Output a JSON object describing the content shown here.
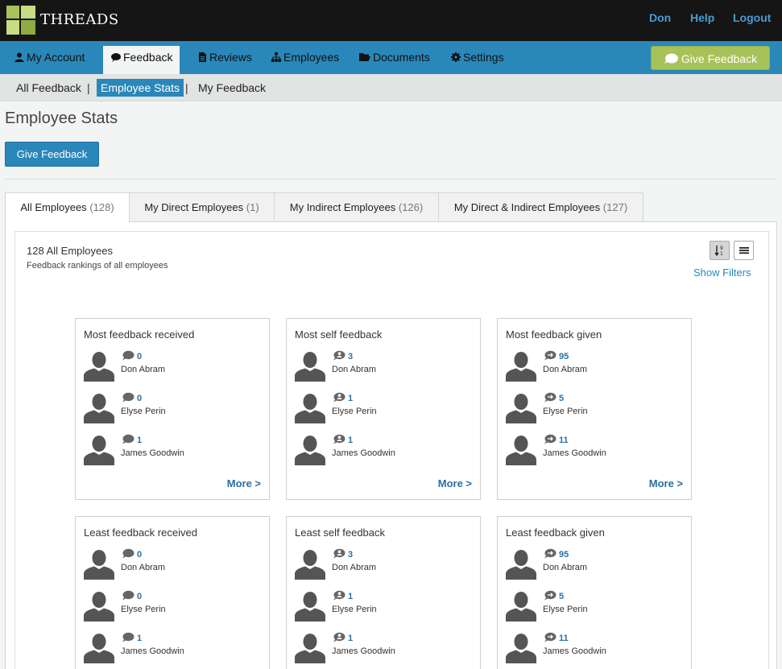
{
  "app": {
    "brand": "THREADS",
    "top_links": [
      "Don",
      "Help",
      "Logout"
    ]
  },
  "nav": {
    "items": [
      {
        "label": "My Account",
        "icon": "user-icon"
      },
      {
        "label": "Feedback",
        "icon": "comment-icon",
        "active": true
      },
      {
        "label": "Reviews",
        "icon": "file-icon"
      },
      {
        "label": "Employees",
        "icon": "sitemap-icon"
      },
      {
        "label": "Documents",
        "icon": "folder-icon"
      },
      {
        "label": "Settings",
        "icon": "gear-icon"
      }
    ],
    "give_feedback": "Give Feedback"
  },
  "subnav": {
    "items": [
      "All Feedback",
      "Employee Stats",
      "My Feedback"
    ],
    "separator": "|",
    "active_index": 1
  },
  "page": {
    "title": "Employee Stats",
    "give_feedback_button": "Give Feedback"
  },
  "tabs": [
    {
      "label": "All Employees",
      "count": "(128)",
      "active": true
    },
    {
      "label": "My Direct Employees",
      "count": "(1)"
    },
    {
      "label": "My Indirect Employees",
      "count": "(126)"
    },
    {
      "label": "My Direct & Indirect Employees",
      "count": "(127)"
    }
  ],
  "panel": {
    "title": "128 All Employees",
    "subtitle": "Feedback rankings of all employees",
    "show_filters": "Show Filters"
  },
  "colors": {
    "primary": "#2a87b9",
    "accent_green": "#a8c25a",
    "topbar": "#151515",
    "link": "#2a6fa3"
  },
  "cards": [
    {
      "title": "Most feedback received",
      "icon": "comment-icon",
      "entries": [
        {
          "count": "0",
          "name": "Don Abram"
        },
        {
          "count": "0",
          "name": "Elyse Perin"
        },
        {
          "count": "1",
          "name": "James Goodwin"
        }
      ],
      "more": "More >"
    },
    {
      "title": "Most self feedback",
      "icon": "self-comment-icon",
      "entries": [
        {
          "count": "3",
          "name": "Don Abram"
        },
        {
          "count": "1",
          "name": "Elyse Perin"
        },
        {
          "count": "1",
          "name": "James Goodwin"
        }
      ],
      "more": "More >"
    },
    {
      "title": "Most feedback given",
      "icon": "give-comment-icon",
      "entries": [
        {
          "count": "95",
          "name": "Don Abram"
        },
        {
          "count": "5",
          "name": "Elyse Perin"
        },
        {
          "count": "11",
          "name": "James Goodwin"
        }
      ],
      "more": "More >"
    },
    {
      "title": "Least feedback received",
      "icon": "comment-icon",
      "entries": [
        {
          "count": "0",
          "name": "Don Abram"
        },
        {
          "count": "0",
          "name": "Elyse Perin"
        },
        {
          "count": "1",
          "name": "James Goodwin"
        }
      ]
    },
    {
      "title": "Least self feedback",
      "icon": "self-comment-icon",
      "entries": [
        {
          "count": "3",
          "name": "Don Abram"
        },
        {
          "count": "1",
          "name": "Elyse Perin"
        },
        {
          "count": "1",
          "name": "James Goodwin"
        }
      ]
    },
    {
      "title": "Least feedback given",
      "icon": "give-comment-icon",
      "entries": [
        {
          "count": "95",
          "name": "Don Abram"
        },
        {
          "count": "5",
          "name": "Elyse Perin"
        },
        {
          "count": "11",
          "name": "James Goodwin"
        }
      ]
    }
  ]
}
